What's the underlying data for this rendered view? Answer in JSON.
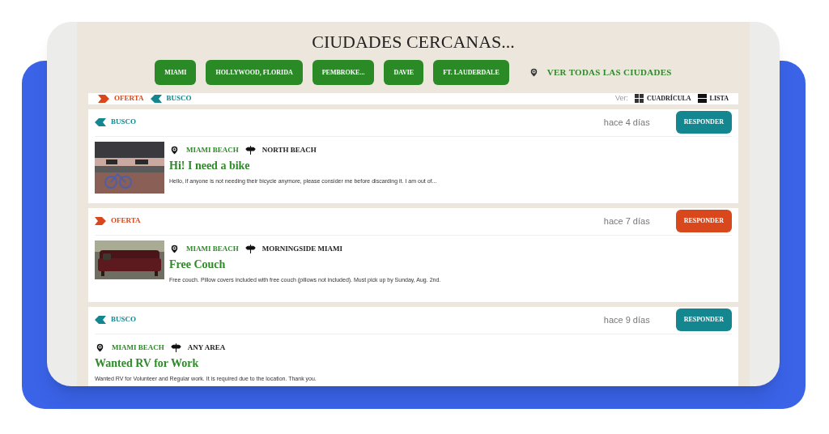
{
  "heading": "CIUDADES CERCANAS...",
  "cities": [
    "MIAMI",
    "HOLLYWOOD, FLORIDA",
    "PEMBROKE...",
    "DAVIE",
    "FT. LAUDERDALE"
  ],
  "all_cities_link": "VER TODAS LAS CIUDADES",
  "legend": [
    {
      "kind": "oferta",
      "label": "OFERTA"
    },
    {
      "kind": "busco",
      "label": "BUSCO"
    }
  ],
  "view": {
    "label": "Ver:",
    "options": [
      {
        "kind": "grid",
        "label": "CUADRÍCULA"
      },
      {
        "kind": "list",
        "label": "LISTA"
      }
    ]
  },
  "posts": [
    {
      "kind": "busco",
      "tag": "BUSCO",
      "time": "hace 4 días",
      "button": "RESPONDER",
      "city": "MIAMI BEACH",
      "area": "NORTH BEACH",
      "title": "Hi! I need a bike",
      "text": "Hello, if anyone is not needing their bicycle anymore, please consider me before discarding it. I am out of..."
    },
    {
      "kind": "oferta",
      "tag": "OFERTA",
      "time": "hace 7 días",
      "button": "RESPONDER",
      "city": "MIAMI BEACH",
      "area": "MORNINGSIDE MIAMI",
      "title": "Free Couch",
      "text": "Free couch. Pillow covers included with free couch (pillows not included). Must pick up by Sunday, Aug. 2nd."
    },
    {
      "kind": "busco",
      "tag": "BUSCO",
      "time": "hace 9 días",
      "button": "RESPONDER",
      "city": "MIAMI BEACH",
      "area": "ANY AREA",
      "title": "Wanted RV for Work",
      "text": "Wanted RV for Volunteer and Regular work. It is required due to the location. Thank you."
    }
  ]
}
